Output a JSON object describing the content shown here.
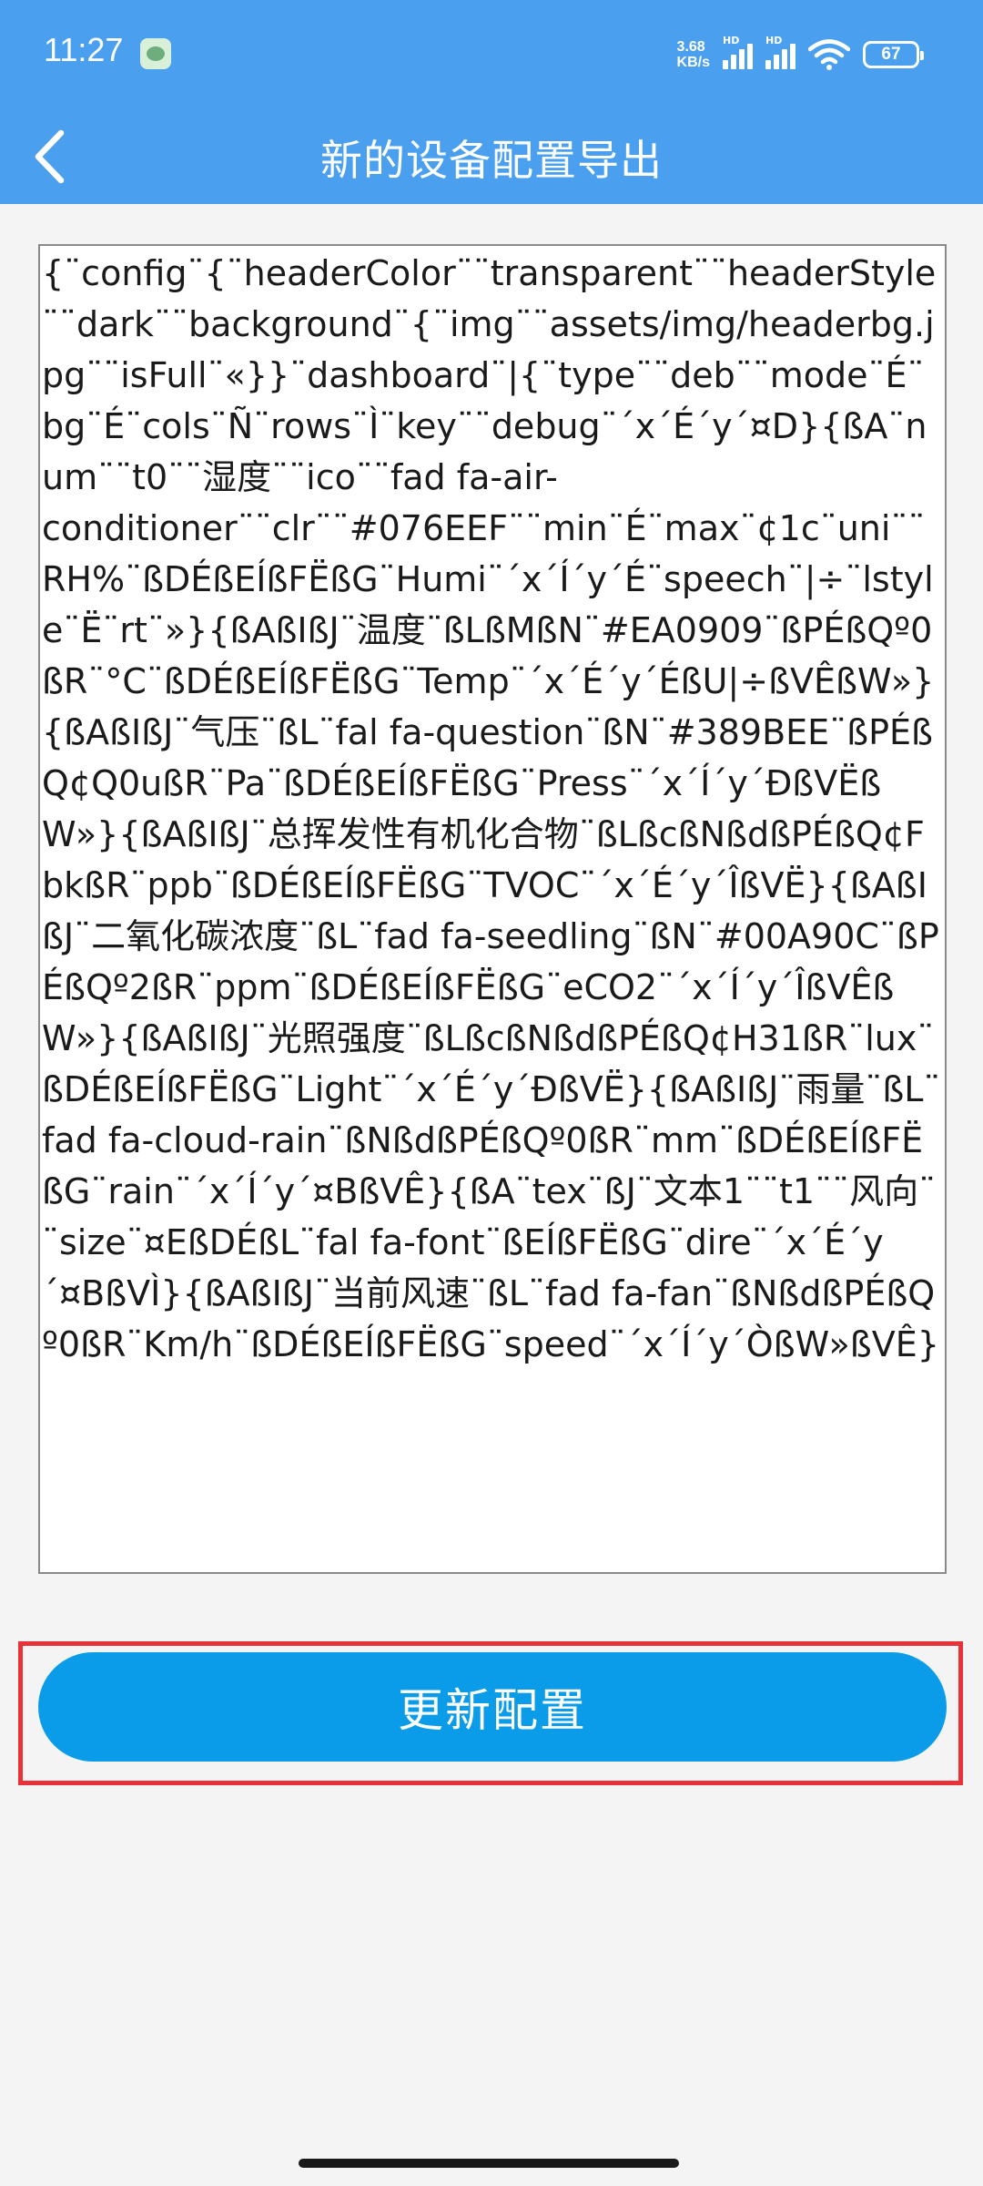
{
  "status_bar": {
    "time": "11:27",
    "net_speed_value": "3.68",
    "net_speed_unit": "KB/s",
    "signal_tag": "HD",
    "battery": "67"
  },
  "nav": {
    "title": "新的设备配置导出"
  },
  "config": {
    "content": "{¨config¨{¨headerColor¨¨transparent¨¨headerStyle¨¨dark¨¨background¨{¨img¨¨assets/img/headerbg.jpg¨¨isFull¨«}}¨dashboard¨|{¨type¨¨deb¨¨mode¨É¨bg¨É¨cols¨Ñ¨rows¨Ì¨key¨¨debug¨´x´É´y´¤D}{ßA¨num¨¨t0¨¨湿度¨¨ico¨¨fad fa-air-\nconditioner¨¨clr¨¨#076EEF¨¨min¨É¨max¨¢1c¨uni¨¨RH%¨ßDÉßEÍßFËßG¨Humi¨´x´Í´y´É¨speech¨|÷¨lstyle¨Ë¨rt¨»}{ßAßIßJ¨温度¨ßLßMßN¨#EA0909¨ßPÉßQº0ßR¨°C¨ßDÉßEÍßFËßG¨Temp¨´x´É´y´ÉßU|÷ßVÊßW»}{ßAßIßJ¨气压¨ßL¨fal fa-question¨ßN¨#389BEE¨ßPÉßQ¢Q0ußR¨Pa¨ßDÉßEÍßFËßG¨Press¨´x´Í´y´ÐßVËßW»}{ßAßIßJ¨总挥发性有机化合物¨ßLßcßNßdßPÉßQ¢FbkßR¨ppb¨ßDÉßEÍßFËßG¨TVOC¨´x´É´y´ÎßVË}{ßAßIßJ¨二氧化碳浓度¨ßL¨fad fa-seedling¨ßN¨#00A90C¨ßPÉßQº2ßR¨ppm¨ßDÉßEÍßFËßG¨eCO2¨´x´Í´y´ÎßVÊßW»}{ßAßIßJ¨光照强度¨ßLßcßNßdßPÉßQ¢H31ßR¨lux¨ßDÉßEÍßFËßG¨Light¨´x´É´y´ÐßVË}{ßAßIßJ¨雨量¨ßL¨fad fa-cloud-rain¨ßNßdßPÉßQº0ßR¨mm¨ßDÉßEÍßFËßG¨rain¨´x´Í´y´¤BßVÊ}{ßA¨tex¨ßJ¨文本1¨¨t1¨¨风向¨¨size¨¤EßDÉßL¨fal fa-font¨ßEÍßFËßG¨dire¨´x´É´y´¤BßVÌ}{ßAßIßJ¨当前风速¨ßL¨fad fa-fan¨ßNßdßPÉßQº0ßR¨Km/h¨ßDÉßEÍßFËßG¨speed¨´x´Í´y´ÒßW»ßVÊ}"
  },
  "actions": {
    "update_label": "更新配置"
  },
  "icons": {
    "back": "chevron-left-icon",
    "wifi": "wifi-icon",
    "signal": "signal-icon",
    "battery": "battery-icon"
  },
  "colors": {
    "header": "#4aa0ee",
    "button": "#0a9ce8",
    "highlight": "#e8323a",
    "background": "#f4f4f4"
  }
}
